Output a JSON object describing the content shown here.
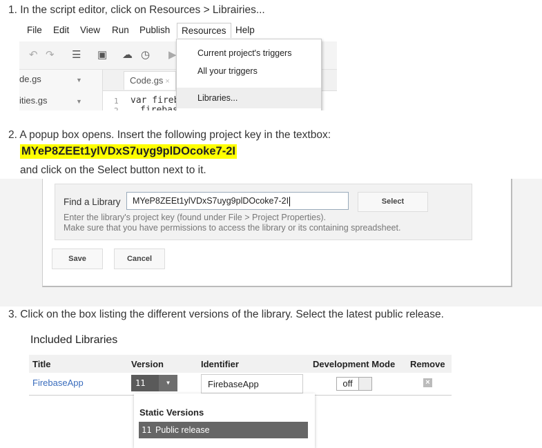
{
  "steps": {
    "step1": "1. In the script editor, click on Resources > Librairies...",
    "step2_line1": "2. A popup box opens. Insert the following project key in the textbox:",
    "project_key": "MYeP8ZEEt1ylVDxS7uyg9plDOcoke7-2I",
    "step2_line2": "and click on the Select button next to it.",
    "step3": "3. Click on the box listing the different versions of the library. Select the latest public release."
  },
  "editor": {
    "menu": [
      "File",
      "Edit",
      "View",
      "Run",
      "Publish",
      "Resources",
      "Help"
    ],
    "files": [
      "de.gs",
      "ities.gs"
    ],
    "tab": "Code.gs",
    "tab_close": "×",
    "line_numbers": [
      "1",
      "2"
    ],
    "code_lines": [
      "var fireb",
      "firebas"
    ],
    "dropdown": [
      "Current project's triggers",
      "All your triggers",
      "Libraries..."
    ],
    "toolbar_icons": [
      "undo-icon",
      "redo-icon",
      "indent-icon",
      "save-icon",
      "cloud-upload-icon",
      "clock-icon",
      "run-icon"
    ]
  },
  "dialog": {
    "find_label": "Find a Library",
    "input_value": "MYeP8ZEEt1ylVDxS7uyg9plDOcoke7-2I",
    "select_label": "Select",
    "hint1": "Enter the library's project key (found under File > Project Properties).",
    "hint2": "Make sure that you have permissions to access the library or its containing spreadsheet.",
    "save_label": "Save",
    "cancel_label": "Cancel"
  },
  "libraries": {
    "heading": "Included Libraries",
    "columns": [
      "Title",
      "Version",
      "Identifier",
      "Development Mode",
      "Remove"
    ],
    "row": {
      "title": "FirebaseApp",
      "version": "11",
      "identifier": "FirebaseApp",
      "dev_mode": "off"
    },
    "version_dropdown": {
      "heading": "Static Versions",
      "item_number": "11",
      "item_label": "Public release"
    }
  },
  "colors": {
    "highlight": "#ffff00",
    "link": "#3a6dbd"
  }
}
